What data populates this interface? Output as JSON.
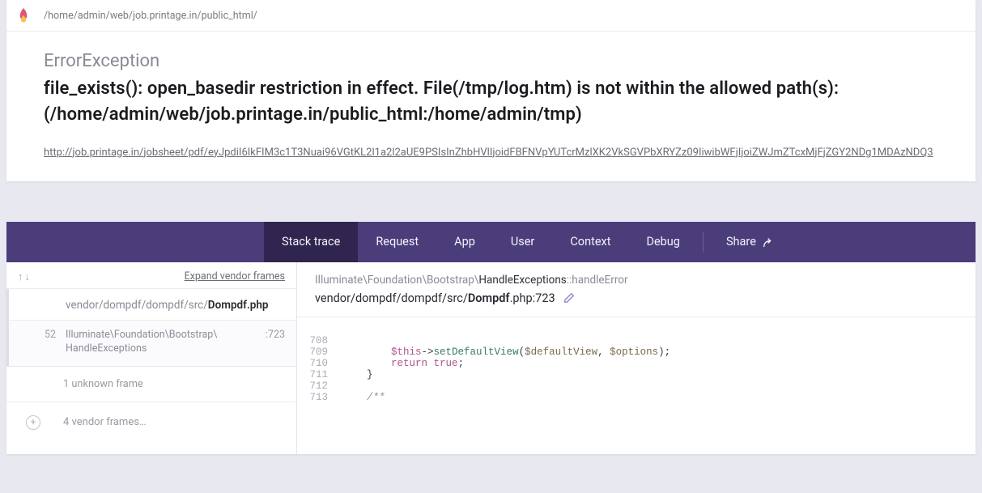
{
  "header": {
    "app_path": "/home/admin/web/job.printage.in/public_html/"
  },
  "exception": {
    "type": "ErrorException",
    "message": "file_exists(): open_basedir restriction in effect. File(/tmp/log.htm) is not within the allowed path(s): (/home/admin/web/job.printage.in/public_html:/home/admin/tmp)",
    "url": "http://job.printage.in/jobsheet/pdf/eyJpdiI6IkFIM3c1T3Nuai96VGtKL2l1a2l2aUE9PSIsInZhbHVlIjoidFBFNVpYUTcrMzlXK2VkSGVPbXRYZz09IiwibWFjIjoiZWJmZTcxMjFjZGY2NDg1MDAzNDQ3"
  },
  "nav": {
    "stack_trace": "Stack trace",
    "request": "Request",
    "app": "App",
    "user": "User",
    "context": "Context",
    "debug": "Debug",
    "share": "Share"
  },
  "stack": {
    "expand_label": "Expand vendor frames",
    "frame0": {
      "path_dim": "vendor/dompdf/dompdf/src/",
      "path_bold": "Dompdf.php",
      "class_ns": "Illuminate\\Foundation\\Bootstrap\\",
      "class_name": "HandleExceptions",
      "number": "52",
      "line": ":723"
    },
    "unknown": "1 unknown frame",
    "vendor_more": "4 vendor frames…"
  },
  "code": {
    "ns_dim": "Illuminate\\Foundation\\Bootstrap\\",
    "cls": "HandleExceptions",
    "sep": "::",
    "method": "handleError",
    "path_dim": "vendor/dompdf/dompdf/src/",
    "path_bold": "Dompdf",
    "path_ext": ".php",
    "line_sep": ":",
    "line_no": "723",
    "lines": {
      "l708": "708",
      "l709": "709",
      "l710": "710",
      "l711": "711",
      "l712": "712",
      "l713": "713"
    }
  }
}
